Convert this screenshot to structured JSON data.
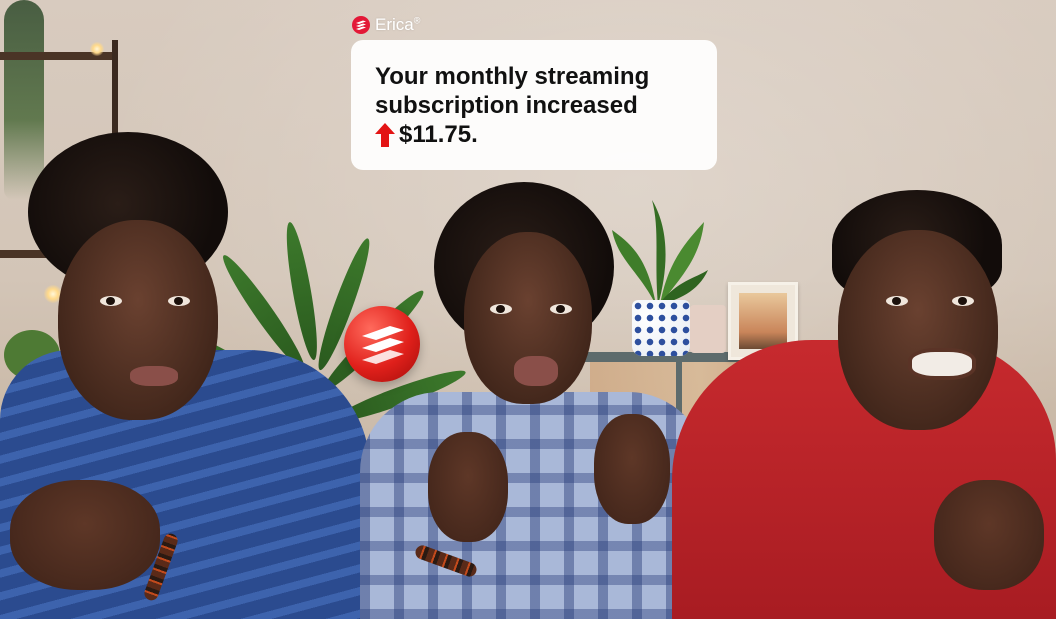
{
  "erica": {
    "name": "Erica",
    "registered_mark": "®",
    "logo_icon": "bank-flag-icon",
    "brand_color": "#e31837"
  },
  "message": {
    "line1": "Your monthly streaming",
    "line2": "subscription increased",
    "amount": "$11.75.",
    "trend_icon": "red-up-arrow-icon",
    "trend_color": "#e31414"
  },
  "scene": {
    "people_count": 3,
    "brand_ball_icon": "bank-flag-logo-ball"
  }
}
